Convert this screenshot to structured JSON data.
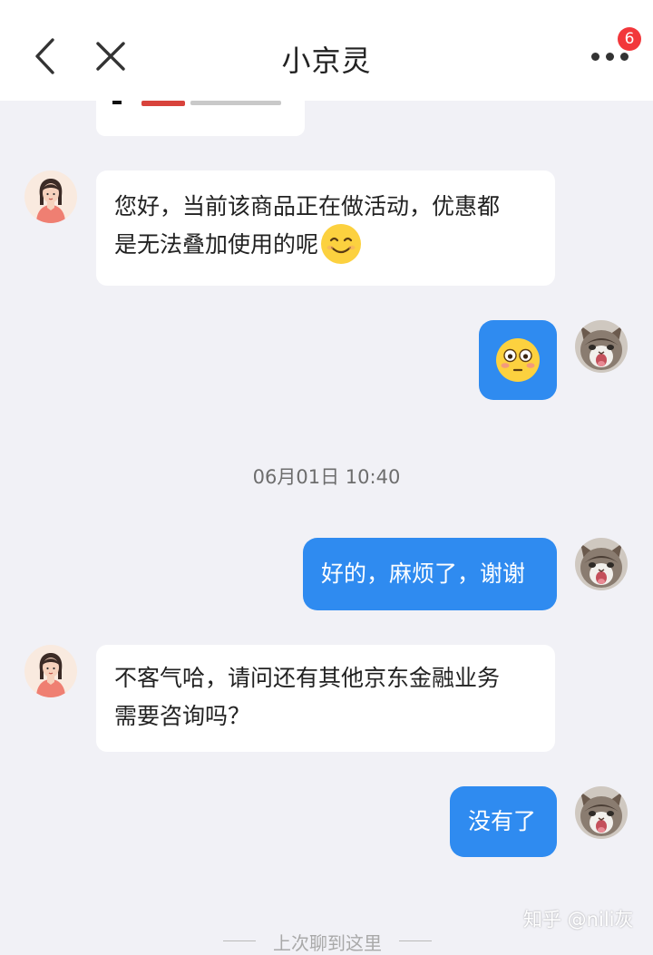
{
  "header": {
    "title": "小京灵",
    "notification_count": "6"
  },
  "messages": [
    {
      "side": "incoming",
      "line1": "您好，当前该商品正在做活动，优惠都",
      "line2": "是无法叠加使用的呢",
      "emoji": "smiling-face-icon"
    },
    {
      "side": "outgoing",
      "emoji": "flushed-face-icon"
    },
    {
      "side": "outgoing",
      "text": "好的，麻烦了，谢谢"
    },
    {
      "side": "incoming",
      "line1": "不客气哈，请问还有其他京东金融业务",
      "line2": "需要咨询吗？"
    },
    {
      "side": "outgoing",
      "text": "没有了"
    }
  ],
  "timestamp": "06月01日 10:40",
  "divider_text": "上次聊到这里",
  "watermark": "知乎 @nili灰",
  "colors": {
    "outgoing_bubble": "#2f8bf0",
    "incoming_bubble": "#ffffff",
    "background": "#f1f1f6",
    "badge": "#f2373b"
  }
}
